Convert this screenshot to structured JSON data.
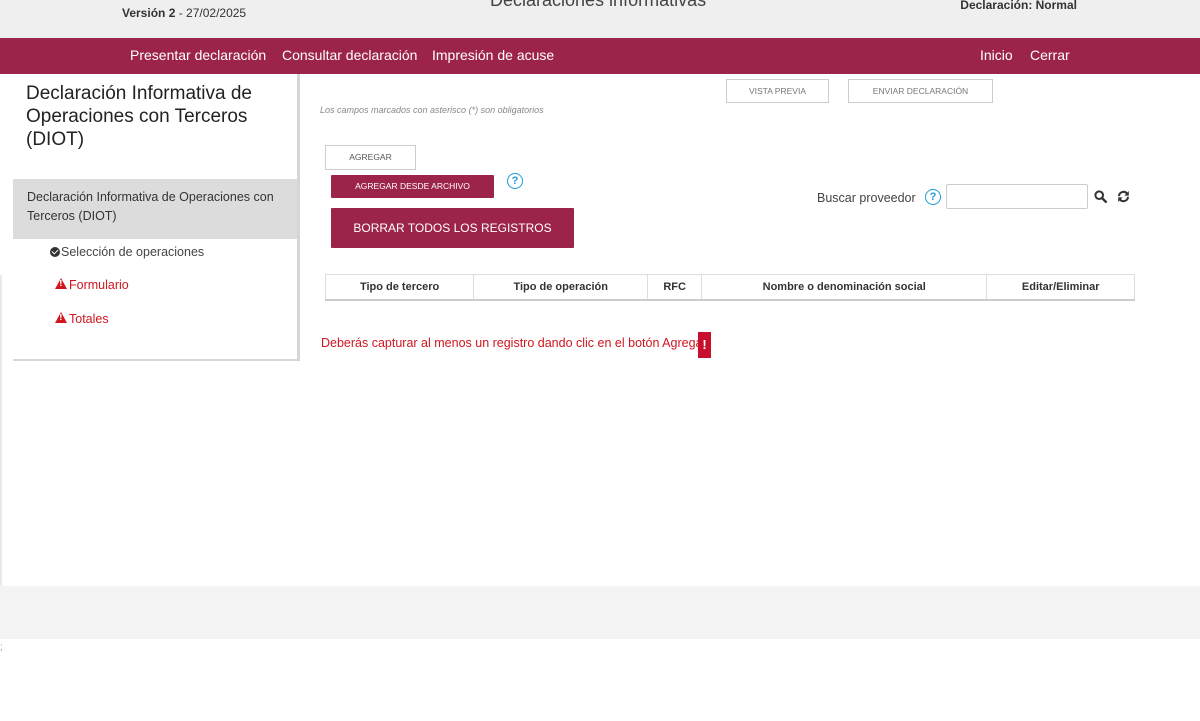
{
  "header": {
    "version_label": "Versión 2",
    "version_date": "- 27/02/2025",
    "app_title": "Declaraciones informativas",
    "declaration_type": "Declaración: Normal"
  },
  "nav": {
    "left": [
      "Presentar declaración",
      "Consultar declaración",
      "Impresión de acuse"
    ],
    "right": [
      "Inicio",
      "Cerrar"
    ]
  },
  "sidebar": {
    "title": "Declaración Informativa de Operaciones con Terceros (DIOT)",
    "active_item": "Declaración Informativa de Operaciones con Terceros (DIOT)",
    "items": [
      {
        "label": "Selección de operaciones",
        "status": "ok"
      },
      {
        "label": "Formulario",
        "status": "warning"
      },
      {
        "label": "Totales",
        "status": "warning"
      }
    ]
  },
  "main": {
    "required_hint": "Los campos marcados con asterisco (*) son obligatorios",
    "preview_button": "VISTA PREVIA",
    "send_button": "ENVIAR DECLARACIÓN",
    "add_button": "AGREGAR",
    "add_from_file_button": "AGREGAR DESDE ARCHIVO",
    "delete_all_button": "BORRAR TODOS LOS REGISTROS",
    "search_label": "Buscar proveedor",
    "search_value": "",
    "table_headers": [
      "Tipo de tercero",
      "Tipo de operación",
      "RFC",
      "Nombre o denominación social",
      "Editar/Eliminar"
    ],
    "error_message": "Deberás capturar al menos un registro dando clic en el botón Agregar.",
    "error_badge": "!"
  },
  "colors": {
    "brand": "#9d2449",
    "error": "#d0161f",
    "help": "#1a9cd8"
  },
  "icons": [
    "check-circle-icon",
    "warning-icon",
    "help-icon",
    "search-icon",
    "refresh-icon"
  ]
}
